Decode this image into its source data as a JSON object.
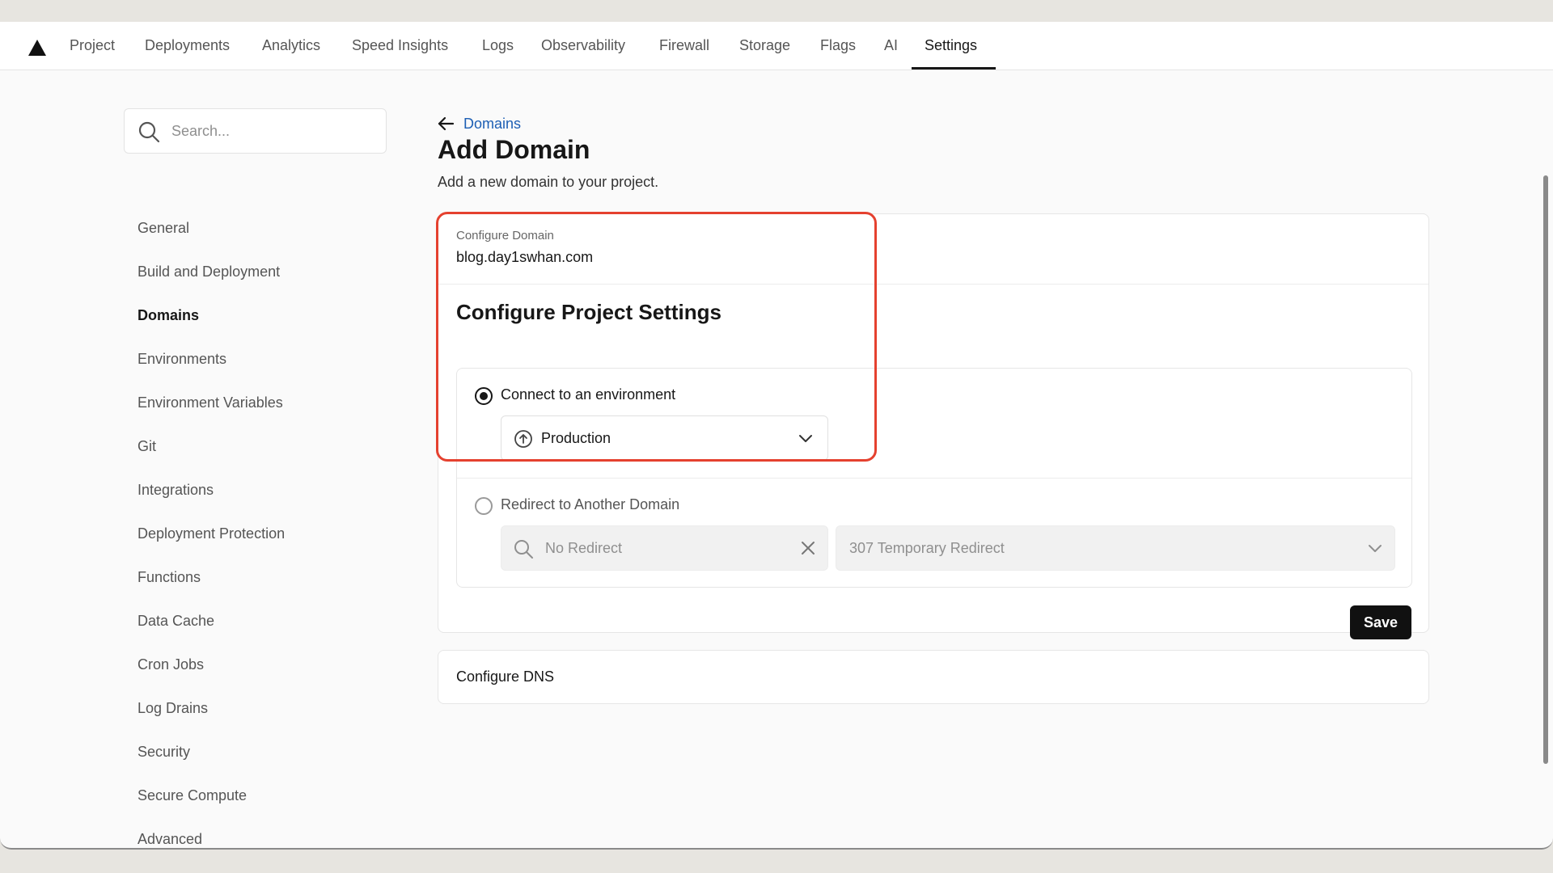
{
  "nav": {
    "items": [
      {
        "label": "Project"
      },
      {
        "label": "Deployments"
      },
      {
        "label": "Analytics"
      },
      {
        "label": "Speed Insights"
      },
      {
        "label": "Logs"
      },
      {
        "label": "Observability"
      },
      {
        "label": "Firewall"
      },
      {
        "label": "Storage"
      },
      {
        "label": "Flags"
      },
      {
        "label": "AI"
      },
      {
        "label": "Settings"
      }
    ],
    "active": "Settings"
  },
  "sidebar": {
    "search_placeholder": "Search...",
    "items": [
      {
        "label": "General"
      },
      {
        "label": "Build and Deployment"
      },
      {
        "label": "Domains"
      },
      {
        "label": "Environments"
      },
      {
        "label": "Environment Variables"
      },
      {
        "label": "Git"
      },
      {
        "label": "Integrations"
      },
      {
        "label": "Deployment Protection"
      },
      {
        "label": "Functions"
      },
      {
        "label": "Data Cache"
      },
      {
        "label": "Cron Jobs"
      },
      {
        "label": "Log Drains"
      },
      {
        "label": "Security"
      },
      {
        "label": "Secure Compute"
      },
      {
        "label": "Advanced"
      }
    ],
    "active": "Domains"
  },
  "main": {
    "back_label": "Domains",
    "title": "Add Domain",
    "subtitle": "Add a new domain to your project.",
    "configure_domain_label": "Configure Domain",
    "domain": "blog.day1swhan.com",
    "project_settings_title": "Configure Project Settings",
    "option_connect_label": "Connect to an environment",
    "option_connect_selected": true,
    "environment_value": "Production",
    "option_redirect_label": "Redirect to Another Domain",
    "option_redirect_selected": false,
    "redirect_placeholder": "No Redirect",
    "redirect_type": "307 Temporary Redirect",
    "save_label": "Save",
    "dns_label": "Configure DNS"
  },
  "colors": {
    "accent_link": "#1d5fb4",
    "highlight": "#e5412f",
    "primary_button": "#111111"
  }
}
